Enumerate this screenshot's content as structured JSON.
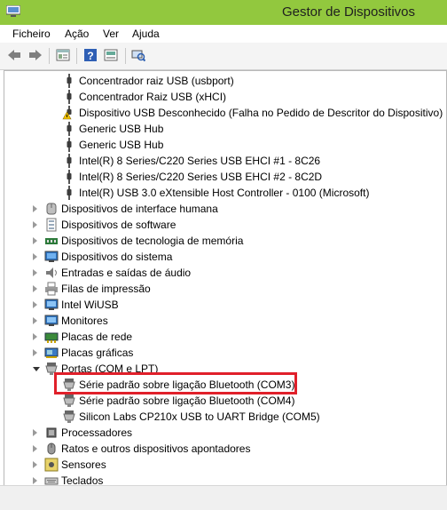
{
  "window": {
    "title": "Gestor de Dispositivos"
  },
  "menu": [
    "Ficheiro",
    "Ação",
    "Ver",
    "Ajuda"
  ],
  "toolbar_icons": [
    "back-icon",
    "forward-icon",
    "properties-icon",
    "help-icon",
    "update-driver-icon",
    "scan-hardware-icon"
  ],
  "usb_children": [
    {
      "label": "Concentrador raiz USB (usbport)",
      "icon": "usb-plug-icon"
    },
    {
      "label": "Concentrador Raiz USB (xHCI)",
      "icon": "usb-plug-icon"
    },
    {
      "label": "Dispositivo USB Desconhecido (Falha no Pedido de Descritor do Dispositivo)",
      "icon": "warning-usb-icon"
    },
    {
      "label": "Generic USB Hub",
      "icon": "usb-plug-icon"
    },
    {
      "label": "Generic USB Hub",
      "icon": "usb-plug-icon"
    },
    {
      "label": "Intel(R) 8 Series/C220 Series USB EHCI #1 - 8C26",
      "icon": "usb-plug-icon"
    },
    {
      "label": "Intel(R) 8 Series/C220 Series USB EHCI #2 - 8C2D",
      "icon": "usb-plug-icon"
    },
    {
      "label": "Intel(R) USB 3.0 eXtensible Host Controller - 0100 (Microsoft)",
      "icon": "usb-plug-icon"
    }
  ],
  "categories_a": [
    {
      "label": "Dispositivos de interface humana",
      "icon": "hid-icon"
    },
    {
      "label": "Dispositivos de software",
      "icon": "software-device-icon"
    },
    {
      "label": "Dispositivos de tecnologia de memória",
      "icon": "memory-icon"
    },
    {
      "label": "Dispositivos do sistema",
      "icon": "system-device-icon"
    },
    {
      "label": "Entradas e saídas de áudio",
      "icon": "audio-icon"
    },
    {
      "label": "Filas de impressão",
      "icon": "printer-icon"
    },
    {
      "label": "Intel WiUSB",
      "icon": "monitor-icon"
    },
    {
      "label": "Monitores",
      "icon": "monitor-icon"
    },
    {
      "label": "Placas de rede",
      "icon": "network-icon"
    },
    {
      "label": "Placas gráficas",
      "icon": "display-adapter-icon"
    }
  ],
  "ports": {
    "label": "Portas (COM e LPT)",
    "children": [
      "Série padrão sobre ligação Bluetooth (COM3)",
      "Série padrão sobre ligação Bluetooth (COM4)",
      "Silicon Labs CP210x USB to UART Bridge (COM5)"
    ]
  },
  "categories_b": [
    {
      "label": "Processadores",
      "icon": "processor-icon"
    },
    {
      "label": "Ratos e outros dispositivos apontadores",
      "icon": "mouse-icon"
    },
    {
      "label": "Sensores",
      "icon": "sensor-icon"
    },
    {
      "label": "Teclados",
      "icon": "keyboard-icon"
    }
  ],
  "colors": {
    "titlebar": "#92c83e",
    "highlight": "#e0202a"
  }
}
